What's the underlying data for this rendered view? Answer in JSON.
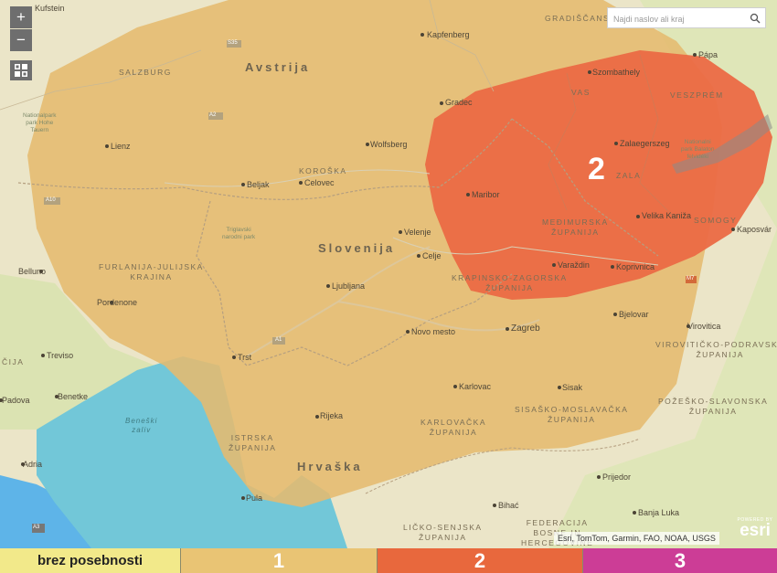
{
  "map": {
    "countries": {
      "austria": "Avstrija",
      "slovenia": "Slovenija",
      "croatia": "Hrvaška"
    },
    "zone_number": "2",
    "regions": {
      "salzburg": "SALZBURG",
      "koroska": "KOROŠKA",
      "furlanija": "FURLANIJA-JULIJSKA\nKRAJINA",
      "vas": "VAS",
      "veszprem": "VESZPRÉM",
      "zala": "ZALA",
      "somogy": "SOMOGY",
      "medjimurska": "MEĐIMURSKA\nŽUPANIJA",
      "krapinsko": "KRAPINSKO-ZAGORSKA\nŽUPANIJA",
      "viroviticko": "VIROVITIČKO-PODRAVSKA\nŽUPANIJA",
      "pozesko": "POŽEŠKO-SLAVONSKA\nŽUPANIJA",
      "sisacko": "SISAŠKO-MOSLAVAČKA\nŽUPANIJA",
      "karlovacka": "KARLOVAČKA\nŽUPANIJA",
      "istarska": "ISTRSKA\nŽUPANIJA",
      "licko": "LIČKO-SENJSKA\nŽUPANIJA",
      "federacija": "FEDERACIJA\nBOSNE IN\nHERCEGOVINE",
      "gradiscansko": "GRADIŠČANSKO",
      "cija": "ČIJA"
    },
    "parks": {
      "hohe_tauern": "Nationalpark\npark Hohe\nTauern",
      "triglav": "Triglavski\nnarodni park",
      "balaton": "Nationalni\npark Balaton\nfelvidéki"
    },
    "sea": "Beneški\nzaliv",
    "cities": {
      "kufstein": "Kufstein",
      "kapfenberg": "Kapfenberg",
      "papa": "Pápa",
      "szombathely": "Szombathely",
      "graz": "Gradec",
      "lienz": "Lienz",
      "wolfsberg": "Wolfsberg",
      "zalaegerszeg": "Zalaegerszeg",
      "beljak": "Beljak",
      "celovec": "Celovec",
      "maribor": "Maribor",
      "velenje": "Velenje",
      "velika_kaniza": "Velika Kaniža",
      "kaposvar": "Kaposvár",
      "celje": "Celje",
      "varazdin": "Varaždin",
      "belluno": "Belluno",
      "koprivnica": "Koprivnica",
      "ljubljana": "Ljubljana",
      "pordenone": "Pordenone",
      "bjelovar": "Bjelovar",
      "zagreb": "Zagreb",
      "novo_mesto": "Novo mesto",
      "virovitica": "Virovitica",
      "treviso": "Treviso",
      "trst": "Trst",
      "padova": "Padova",
      "benetke": "Benetke",
      "karlovac": "Karlovac",
      "sisak": "Sisak",
      "rijeka": "Rijeka",
      "adria": "Adria",
      "prijedor": "Prijedor",
      "pula": "Pula",
      "bihac": "Bihać",
      "banja_luka": "Banja Luka"
    },
    "road_shields": [
      "A1",
      "A2",
      "S35",
      "A10",
      "M7",
      "A3"
    ]
  },
  "search": {
    "placeholder": "Najdi naslov ali kraj"
  },
  "controls": {
    "zoom_in": "+",
    "zoom_out": "−"
  },
  "attribution": "Esri, TomTom, Garmin, FAO, NOAA, USGS",
  "esri": {
    "powered": "POWERED BY",
    "name": "esri"
  },
  "legend": [
    {
      "label": "brez posebnosti",
      "color": "#f2e98a"
    },
    {
      "label": "1",
      "color": "#e9c474"
    },
    {
      "label": "2",
      "color": "#e8683d"
    },
    {
      "label": "3",
      "color": "#cc3d96"
    }
  ],
  "colors": {
    "zone1": "#e7bf72",
    "zone2": "#ec6a45",
    "sea": "#6fc6d7",
    "land": "#ece6c9"
  }
}
